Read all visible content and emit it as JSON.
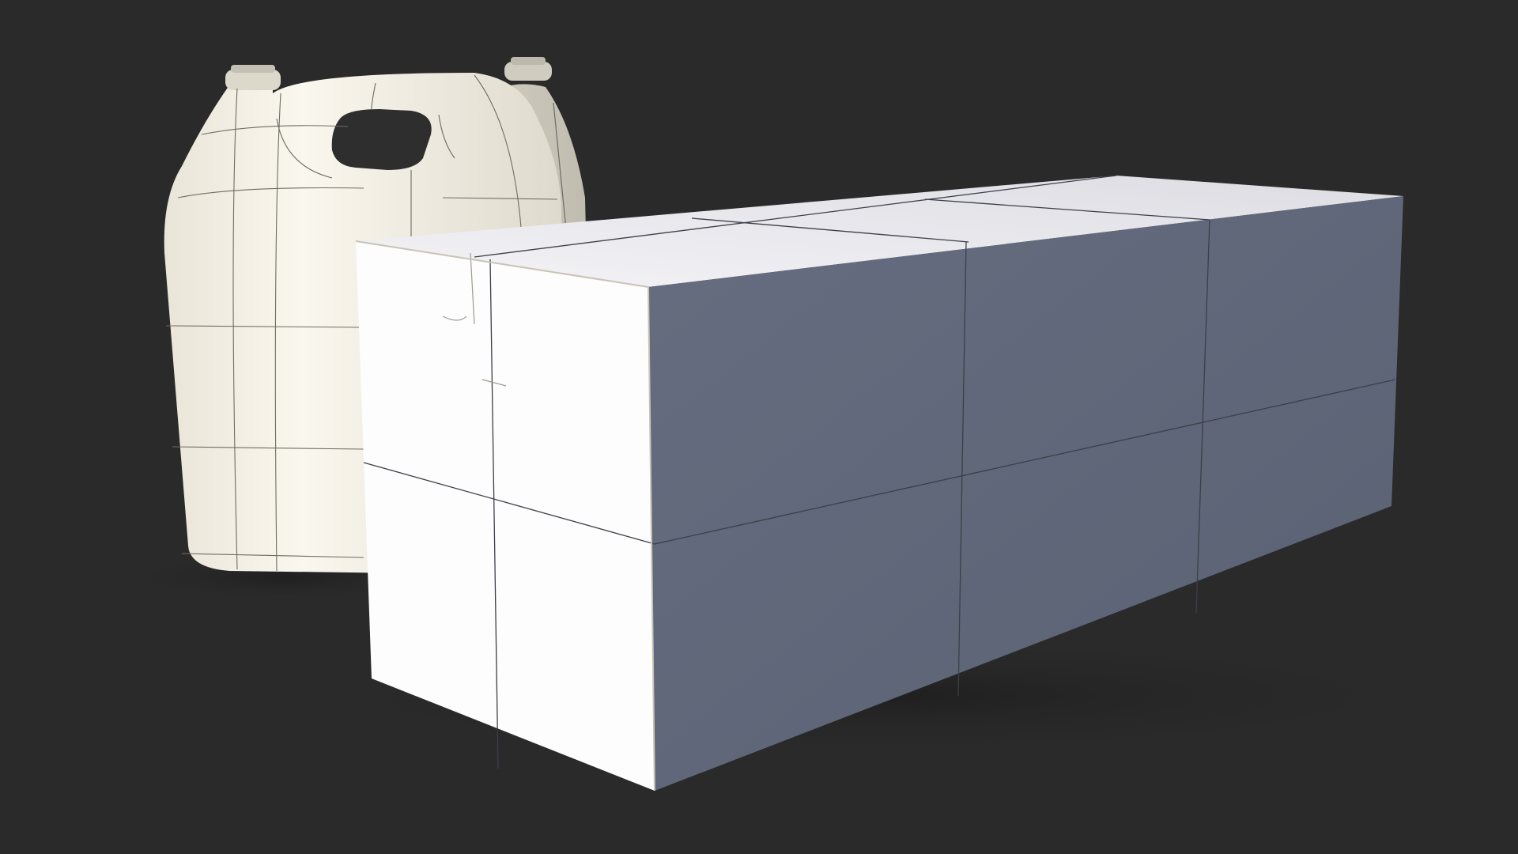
{
  "colors": {
    "background": "#2a2a2a",
    "jug_body": "#f4f1e8",
    "jug_shadow": "#d9d5c8",
    "box_front": "#fbfbfb",
    "box_side": "#5f6678",
    "box_top": "#ececf0",
    "mesh_lines": "#4a4a4a"
  },
  "objects": [
    {
      "name": "rear-jug",
      "type": "plastic canister"
    },
    {
      "name": "front-jug",
      "type": "plastic canister"
    },
    {
      "name": "shipping-box",
      "type": "cardboard box"
    }
  ]
}
